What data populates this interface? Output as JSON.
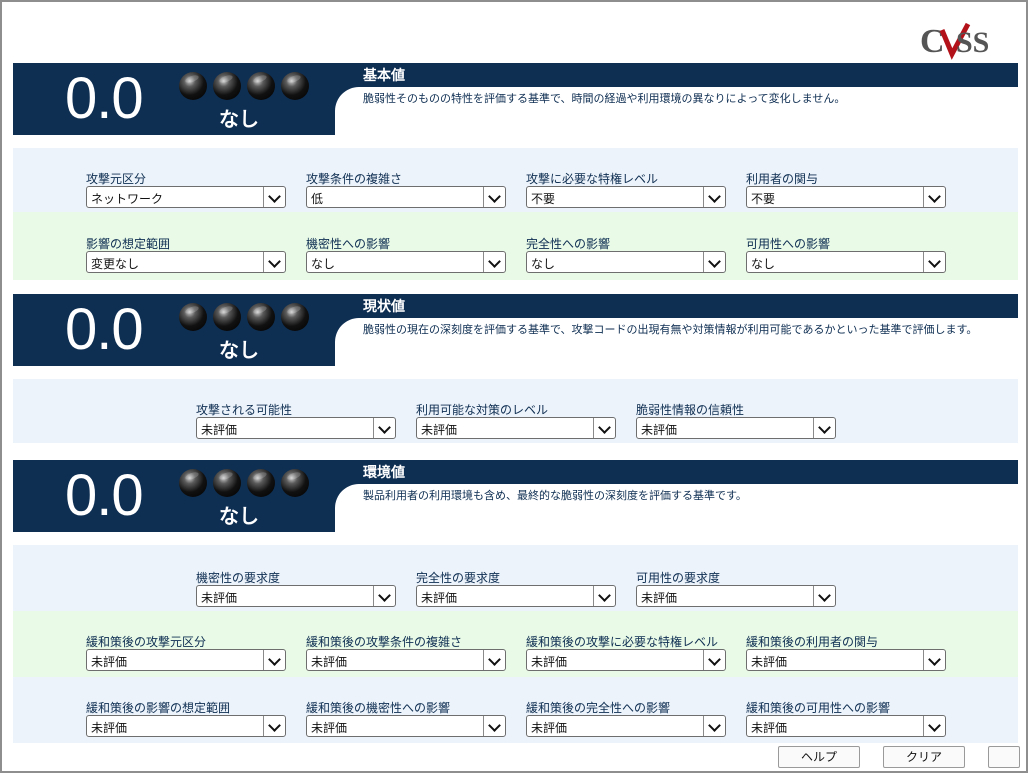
{
  "logo": {
    "text": "CVSS",
    "icon": "cvss-logo"
  },
  "sections": [
    {
      "title": "基本値",
      "score": "0.0",
      "severity": "なし",
      "rating_dots": 4,
      "description": "脆弱性そのものの特性を評価する基準で、時間の経過や利用環境の異なりによって変化しません。"
    },
    {
      "title": "現状値",
      "score": "0.0",
      "severity": "なし",
      "rating_dots": 4,
      "description": "脆弱性の現在の深刻度を評価する基準で、攻撃コードの出現有無や対策情報が利用可能であるかといった基準で評価します。"
    },
    {
      "title": "環境値",
      "score": "0.0",
      "severity": "なし",
      "rating_dots": 4,
      "description": "製品利用者の利用環境も含め、最終的な脆弱性の深刻度を評価する基準です。"
    }
  ],
  "base": {
    "row1": [
      {
        "label": "攻撃元区分",
        "value": "ネットワーク"
      },
      {
        "label": "攻撃条件の複雑さ",
        "value": "低"
      },
      {
        "label": "攻撃に必要な特権レベル",
        "value": "不要"
      },
      {
        "label": "利用者の関与",
        "value": "不要"
      }
    ],
    "row2": [
      {
        "label": "影響の想定範囲",
        "value": "変更なし"
      },
      {
        "label": "機密性への影響",
        "value": "なし"
      },
      {
        "label": "完全性への影響",
        "value": "なし"
      },
      {
        "label": "可用性への影響",
        "value": "なし"
      }
    ]
  },
  "temporal": {
    "row1": [
      {
        "label": "攻撃される可能性",
        "value": "未評価"
      },
      {
        "label": "利用可能な対策のレベル",
        "value": "未評価"
      },
      {
        "label": "脆弱性情報の信頼性",
        "value": "未評価"
      }
    ]
  },
  "environmental": {
    "row1": [
      {
        "label": "機密性の要求度",
        "value": "未評価"
      },
      {
        "label": "完全性の要求度",
        "value": "未評価"
      },
      {
        "label": "可用性の要求度",
        "value": "未評価"
      }
    ],
    "row2": [
      {
        "label": "緩和策後の攻撃元区分",
        "value": "未評価"
      },
      {
        "label": "緩和策後の攻撃条件の複雑さ",
        "value": "未評価"
      },
      {
        "label": "緩和策後の攻撃に必要な特権レベル",
        "value": "未評価"
      },
      {
        "label": "緩和策後の利用者の関与",
        "value": "未評価"
      }
    ],
    "row3": [
      {
        "label": "緩和策後の影響の想定範囲",
        "value": "未評価"
      },
      {
        "label": "緩和策後の機密性への影響",
        "value": "未評価"
      },
      {
        "label": "緩和策後の完全性への影響",
        "value": "未評価"
      },
      {
        "label": "緩和策後の可用性への影響",
        "value": "未評価"
      }
    ]
  },
  "buttons": {
    "help": "ヘルプ",
    "clear": "クリア",
    "extra": ""
  },
  "colors": {
    "navy": "#0e2e52",
    "row_blue": "#edf3fa",
    "row_green": "#e9fae6"
  }
}
